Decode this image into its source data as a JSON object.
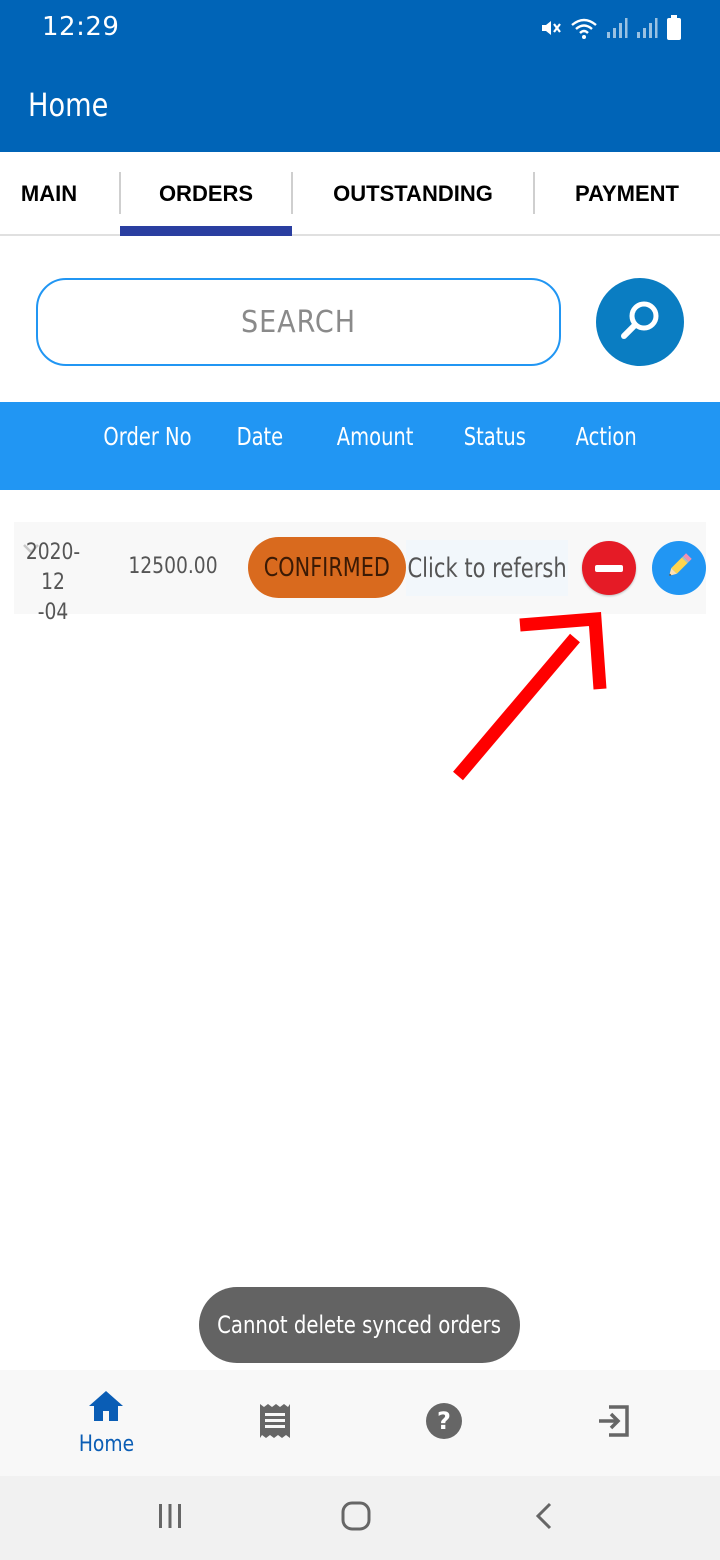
{
  "status_bar": {
    "time": "12:29",
    "icons": [
      "mute-icon",
      "wifi-icon",
      "signal-icon",
      "signal-icon",
      "battery-icon"
    ]
  },
  "app_bar": {
    "title": "Home",
    "color": "#0064b7"
  },
  "tabs": [
    {
      "label": "MAIN",
      "selected": false
    },
    {
      "label": "ORDERS",
      "selected": true
    },
    {
      "label": "OUTSTANDING",
      "selected": false
    },
    {
      "label": "PAYMENT",
      "selected": false
    }
  ],
  "search": {
    "placeholder": "SEARCH",
    "value": "",
    "button_icon": "search-icon"
  },
  "table": {
    "headers": [
      "Order No",
      "Date",
      "Amount",
      "Status",
      "Action"
    ],
    "header_color": "#2196f3",
    "rows": [
      {
        "date": "2020-12\n-04",
        "amount": "12500.00",
        "status": "CONFIRMED",
        "refresh_text": "Click to refersh",
        "actions": [
          "delete-icon",
          "edit-icon"
        ]
      }
    ]
  },
  "toast": {
    "message": "Cannot delete synced orders"
  },
  "bottom_nav": [
    {
      "icon": "home-icon",
      "label": "Home",
      "active": true
    },
    {
      "icon": "receipt-icon",
      "label": "",
      "active": false
    },
    {
      "icon": "help-icon",
      "label": "",
      "active": false
    },
    {
      "icon": "logout-icon",
      "label": "",
      "active": false
    }
  ],
  "system_nav": [
    "recent-apps-icon",
    "home-circle-icon",
    "back-icon"
  ],
  "colors": {
    "status_confirmed": "#d96a1e",
    "delete": "#e51b26",
    "edit": "#2196f3",
    "annotation_arrow": "#ff0000"
  }
}
